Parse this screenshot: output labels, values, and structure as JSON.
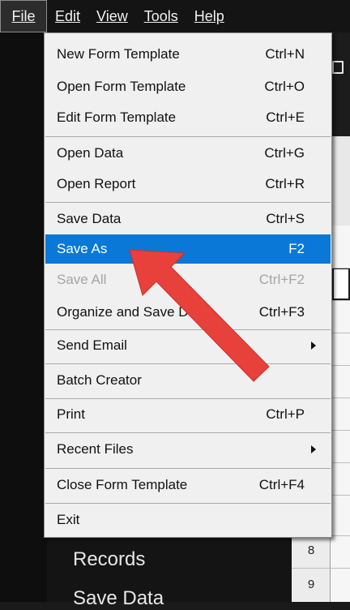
{
  "menubar": {
    "items": [
      {
        "label": "File",
        "active": true
      },
      {
        "label": "Edit"
      },
      {
        "label": "View"
      },
      {
        "label": "Tools"
      },
      {
        "label": "Help"
      }
    ]
  },
  "file_menu": {
    "items": [
      {
        "label": "New Form Template",
        "shortcut": "Ctrl+N"
      },
      {
        "label": "Open Form Template",
        "shortcut": "Ctrl+O"
      },
      {
        "label": "Edit Form Template",
        "shortcut": "Ctrl+E"
      },
      {
        "label": "Open Data",
        "shortcut": "Ctrl+G"
      },
      {
        "label": "Open Report",
        "shortcut": "Ctrl+R"
      },
      {
        "label": "Save Data",
        "shortcut": "Ctrl+S"
      },
      {
        "label": "Save As",
        "shortcut": "F2",
        "state": "highlighted"
      },
      {
        "label": "Save All",
        "shortcut": "Ctrl+F2",
        "state": "disabled"
      },
      {
        "label": "Organize and Save Data",
        "shortcut": "Ctrl+F3"
      },
      {
        "label": "Send Email",
        "submenu": true
      },
      {
        "label": "Batch Creator"
      },
      {
        "label": "Print",
        "shortcut": "Ctrl+P"
      },
      {
        "label": "Recent Files",
        "submenu": true
      },
      {
        "label": "Close Form Template",
        "shortcut": "Ctrl+F4"
      },
      {
        "label": "Exit"
      }
    ]
  },
  "background": {
    "sidebar_labels": [
      "Records",
      "Save Data"
    ],
    "row_numbers": [
      "8",
      "9"
    ]
  },
  "colors": {
    "highlight": "#0a78d7",
    "arrow": "#e8413b",
    "menu_bg": "#f0f0f0",
    "app_bg": "#141414"
  },
  "icons": {
    "submenu": "chevron-right-icon",
    "toolbar": "window-icon"
  }
}
